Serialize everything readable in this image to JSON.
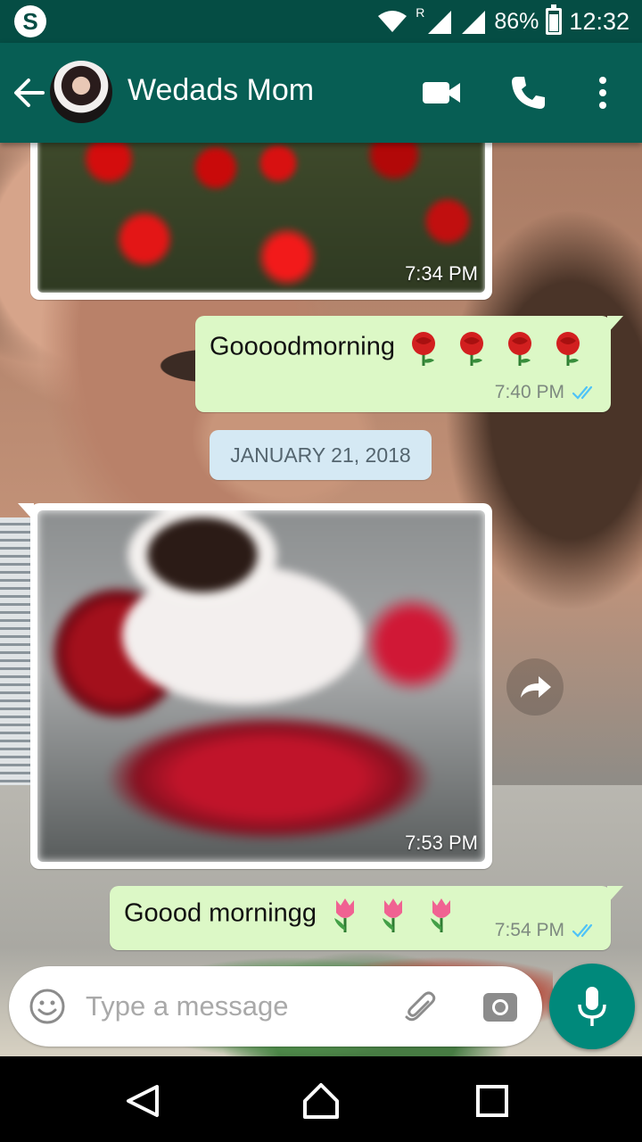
{
  "status_bar": {
    "app_icon": "skype-icon",
    "roaming": "R",
    "battery": "86%",
    "time": "12:32"
  },
  "header": {
    "contact_name": "Wedads Mom",
    "icons": [
      "back-arrow-icon",
      "avatar",
      "video-call-icon",
      "phone-icon",
      "more-vert-icon"
    ]
  },
  "messages": [
    {
      "type": "image",
      "direction": "incoming",
      "time": "7:34 PM",
      "image": "red-roses-photo"
    },
    {
      "type": "text",
      "direction": "outgoing",
      "text": "Goooodmorning",
      "emoji": [
        "rose",
        "rose",
        "rose",
        "rose"
      ],
      "time": "7:40 PM",
      "status": "read"
    },
    {
      "type": "date",
      "text": "JANUARY 21, 2018"
    },
    {
      "type": "image",
      "direction": "incoming",
      "time": "7:53 PM",
      "image": "coffee-and-roses-photo"
    },
    {
      "type": "text",
      "direction": "outgoing",
      "text": "Goood morningg",
      "emoji": [
        "tulip",
        "tulip",
        "tulip"
      ],
      "time": "7:54 PM",
      "status": "read"
    }
  ],
  "composer": {
    "placeholder": "Type a message"
  },
  "colors": {
    "app_bar": "#075e54",
    "status_bar": "#054d44",
    "outgoing_bubble": "#dcf8c6",
    "read_ticks": "#4fc3f7",
    "mic_button": "#00897b",
    "date_chip": "#d5e9f4"
  }
}
